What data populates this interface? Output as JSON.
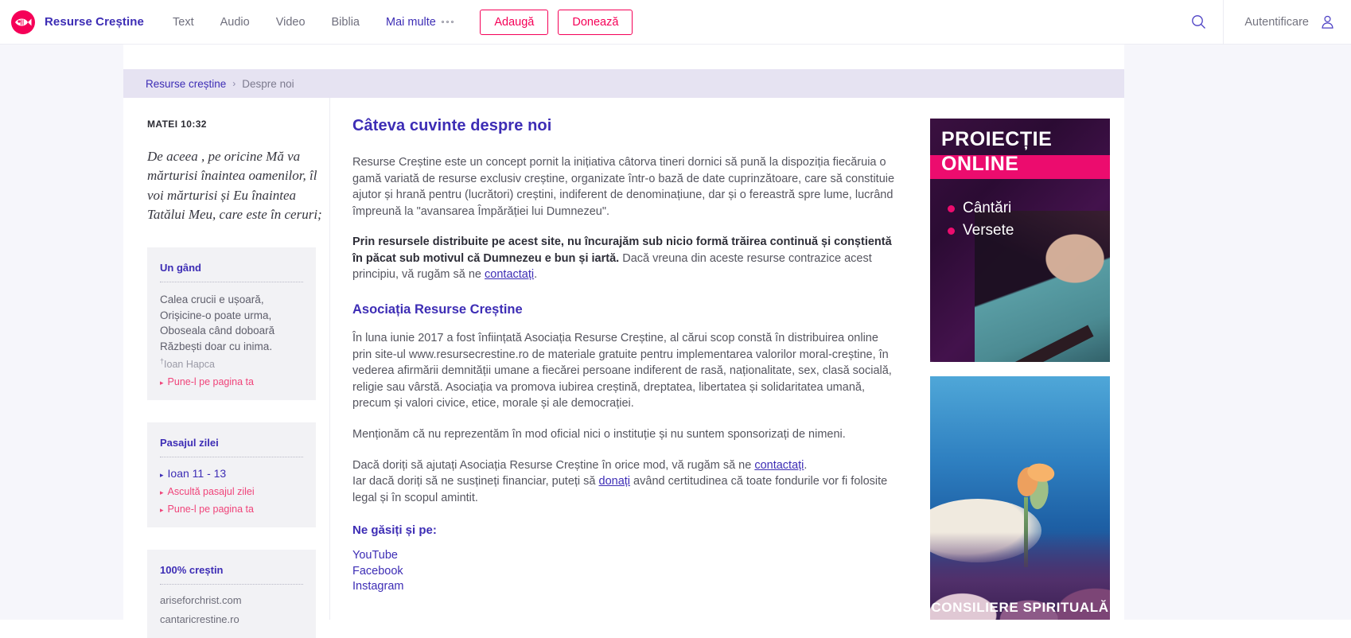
{
  "header": {
    "brand_name": "Resurse Creștine",
    "logo_icon": "fish-logo-icon",
    "logo_color": "#f50057",
    "nav": [
      {
        "label": "Text"
      },
      {
        "label": "Audio"
      },
      {
        "label": "Video"
      },
      {
        "label": "Biblia"
      },
      {
        "label": "Mai multe",
        "accent": true,
        "icon": "ellipsis-icon"
      }
    ],
    "buttons": {
      "add_label": "Adaugă",
      "donate_label": "Donează"
    },
    "search_icon": "search-icon",
    "auth_label": "Autentificare",
    "auth_icon": "user-icon",
    "accent_color": "#f50057",
    "brand_color": "#3d2db5"
  },
  "breadcrumb": {
    "home_label": "Resurse creștine",
    "separator": "›",
    "current_label": "Despre noi"
  },
  "sidebar_left": {
    "verse": {
      "reference": "MATEI 10:32",
      "text": "De aceea , pe oricine Mă va mărturisi înaintea oamenilor, îl voi mărturisi și Eu înaintea Tatălui Meu, care este în ceruri;"
    },
    "cards": [
      {
        "title": "Un gând",
        "text": "Calea crucii e ușoară, Orișicine-o poate urma, Oboseala când doboară Răzbești doar cu inima.",
        "author": "Ioan Hapca",
        "author_mark": "†",
        "links": [
          {
            "label": "Pune-l pe pagina ta",
            "style": "pink"
          }
        ]
      },
      {
        "title": "Pasajul zilei",
        "links": [
          {
            "label": "Ioan 11 - 13",
            "style": "blue"
          },
          {
            "label": "Ascultă pasajul zilei",
            "style": "pink"
          },
          {
            "label": "Pune-l pe pagina ta",
            "style": "pink"
          }
        ]
      },
      {
        "title": "100% creștin",
        "sites": [
          {
            "label": "ariseforchrist.com"
          },
          {
            "label": "cantaricrestine.ro"
          }
        ]
      }
    ]
  },
  "main": {
    "title": "Câteva cuvinte despre noi",
    "p1": "Resurse Creștine este un concept pornit la inițiativa câtorva tineri dornici să pună la dispoziția fiecăruia o gamă variată de resurse exclusiv creștine, organizate într-o bază de date cuprinzătoare, care să constituie ajutor și hrană pentru (lucrători) creștini, indiferent de denominațiune, dar și o fereastră spre lume, lucrând împreună la \"avansarea Împărăției lui Dumnezeu\".",
    "p2_bold": "Prin resursele distribuite pe acest site, nu încurajăm sub nicio formă trăirea continuă și conștientă în păcat sub motivul că Dumnezeu e bun și iartă.",
    "p2_rest": " Dacă vreuna din aceste resurse contrazice acest principiu, vă rugăm să ne ",
    "p2_link": "contactați",
    "p2_end": ".",
    "subtitle": "Asociația Resurse Creștine",
    "p3": "În luna iunie 2017 a fost înființată Asociația Resurse Creștine, al cărui scop constă în distribuirea online prin site-ul www.resursecrestine.ro de materiale gratuite pentru implementarea valorilor moral-creștine, în vederea afirmării demnității umane a fiecărei persoane indiferent de rasă, naționalitate, sex, clasă socială, religie sau vârstă. Asociația va promova iubirea creștină, dreptatea, libertatea și solidaritatea umană, precum și valori civice, etice, morale și ale democrației.",
    "p4": "Menționăm că nu reprezentăm în mod oficial nici o instituție și nu suntem sponsorizați de nimeni.",
    "p5_a": "Dacă doriți să ajutați Asociația Resurse Creștine în orice mod, vă rugăm să ne ",
    "p5_link": "contactați",
    "p5_b": ".",
    "p6_a": "Iar dacă doriți să ne susțineți financiar, puteți să ",
    "p6_link": "donați",
    "p6_b": " având certitudinea că toate fondurile vor fi folosite legal și în scopul amintit.",
    "find_title": "Ne găsiți și pe:",
    "socials": [
      {
        "label": "YouTube"
      },
      {
        "label": "Facebook"
      },
      {
        "label": "Instagram"
      }
    ]
  },
  "sidebar_right": {
    "banners": [
      {
        "name": "proiectie-online-banner",
        "line1": "PROIECȚIE",
        "line2": "ONLINE",
        "bullets": [
          "Cântări",
          "Versete"
        ],
        "accent": "#ec0c6e"
      },
      {
        "name": "consiliere-spirituala-banner",
        "caption": "CONSILIERE SPIRITUALĂ"
      }
    ]
  }
}
